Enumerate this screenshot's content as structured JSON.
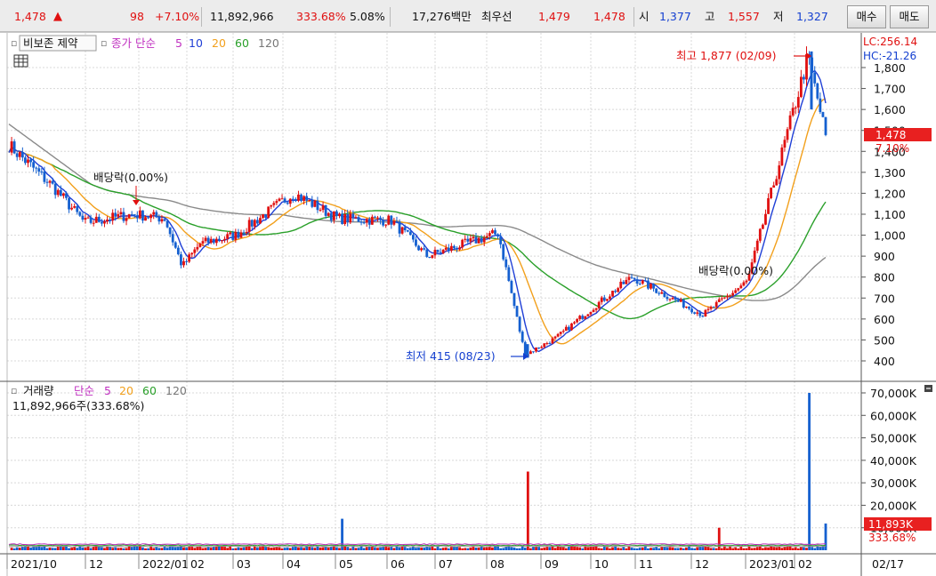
{
  "quote": {
    "price": "1,478",
    "up_arrow": "▲",
    "change": "98",
    "change_pct": "+7.10%",
    "volume": "11,892,966",
    "volume_ratio": "333.68%",
    "turnover": "5.08%",
    "amount": "17,276백만",
    "best_ask_label": "최우선",
    "best_ask": "1,479",
    "best_bid": "1,478",
    "open_label": "시",
    "open": "1,377",
    "high_label": "고",
    "high": "1,557",
    "low_label": "저",
    "low": "1,327",
    "buy_button": "매수",
    "sell_button": "매도"
  },
  "price_panel": {
    "legend": {
      "marker": "▫",
      "toggle": "비보존 제약",
      "kind": "종가 단순",
      "periods": [
        "5",
        "10",
        "20",
        "60",
        "120"
      ]
    },
    "lc_label": "LC:256.14",
    "hc_label": "HC:-21.26",
    "current_price": "1,478",
    "current_pct": "7.10%",
    "high_annotation": "최고 1,877 (02/09)",
    "low_annotation": "최저 415 (08/23)",
    "dividend_label_1": "배당락(0.00%)",
    "dividend_label_2": "배당락(0.00%)",
    "y_ticks": [
      "1,800",
      "1,700",
      "1,600",
      "1,500",
      "1,400",
      "1,300",
      "1,200",
      "1,100",
      "1,000",
      "900",
      "800",
      "700",
      "600",
      "500",
      "400"
    ]
  },
  "volume_panel": {
    "legend_marker": "▫",
    "legend_title": "거래량",
    "legend_kind": "단순",
    "periods": [
      "5",
      "20",
      "60",
      "120"
    ],
    "value_line": "11,892,966주(333.68%)",
    "current_volume": "11,893K",
    "current_ratio": "333.68%",
    "y_ticks": [
      "70,000K",
      "60,000K",
      "50,000K",
      "40,000K",
      "30,000K",
      "20,000K",
      "10,000K"
    ]
  },
  "x_axis": {
    "labels": [
      "2021/10",
      "12",
      "2022/01",
      "02",
      "03",
      "04",
      "05",
      "06",
      "07",
      "08",
      "09",
      "10",
      "11",
      "12",
      "2023/01",
      "02",
      "02/17"
    ]
  },
  "colors": {
    "up": "#e01010",
    "down": "#1560d0",
    "ma5": "#1f3fd6",
    "ma10": "#1f3fd6",
    "ma20": "#f2a01c",
    "ma60": "#2aa02a",
    "ma120": "#8a8a8a"
  },
  "chart_data": {
    "type": "candlestick",
    "title": "비보존 제약",
    "price_range": [
      330,
      1910
    ],
    "volume_range_k": [
      0,
      74000
    ],
    "price_keypoints": [
      {
        "date": "2021/09",
        "close": 1430
      },
      {
        "date": "2021/10",
        "close": 1230
      },
      {
        "date": "2021/11",
        "close": 1060
      },
      {
        "date": "2021/12",
        "close": 1100
      },
      {
        "date": "2022/01",
        "close": 1080
      },
      {
        "date": "2022/01 late",
        "close": 850
      },
      {
        "date": "2022/02",
        "close": 960
      },
      {
        "date": "2022/03",
        "close": 1000
      },
      {
        "date": "2022/04",
        "close": 1200
      },
      {
        "date": "2022/05",
        "close": 1080
      },
      {
        "date": "2022/06",
        "close": 1070
      },
      {
        "date": "2022/07",
        "close": 900
      },
      {
        "date": "2022/08",
        "close": 1010
      },
      {
        "date": "2022/08/23",
        "close": 430
      },
      {
        "date": "2022/09",
        "close": 510
      },
      {
        "date": "2022/10",
        "close": 650
      },
      {
        "date": "2022/11",
        "close": 800
      },
      {
        "date": "2022/12",
        "close": 620
      },
      {
        "date": "2023/01",
        "close": 780
      },
      {
        "date": "2023/02/09",
        "close": 1850
      },
      {
        "date": "2023/02/17",
        "close": 1478
      }
    ],
    "high": {
      "value": 1877,
      "date": "02/09"
    },
    "low": {
      "value": 415,
      "date": "08/23"
    },
    "volume_spikes_k": [
      {
        "date": "2022/04",
        "value": 14000
      },
      {
        "date": "2022/08",
        "value": 35000
      },
      {
        "date": "2022/12",
        "value": 10000
      },
      {
        "date": "2023/02",
        "value": 70000
      },
      {
        "date": "2023/02/17",
        "value": 11893
      }
    ]
  }
}
